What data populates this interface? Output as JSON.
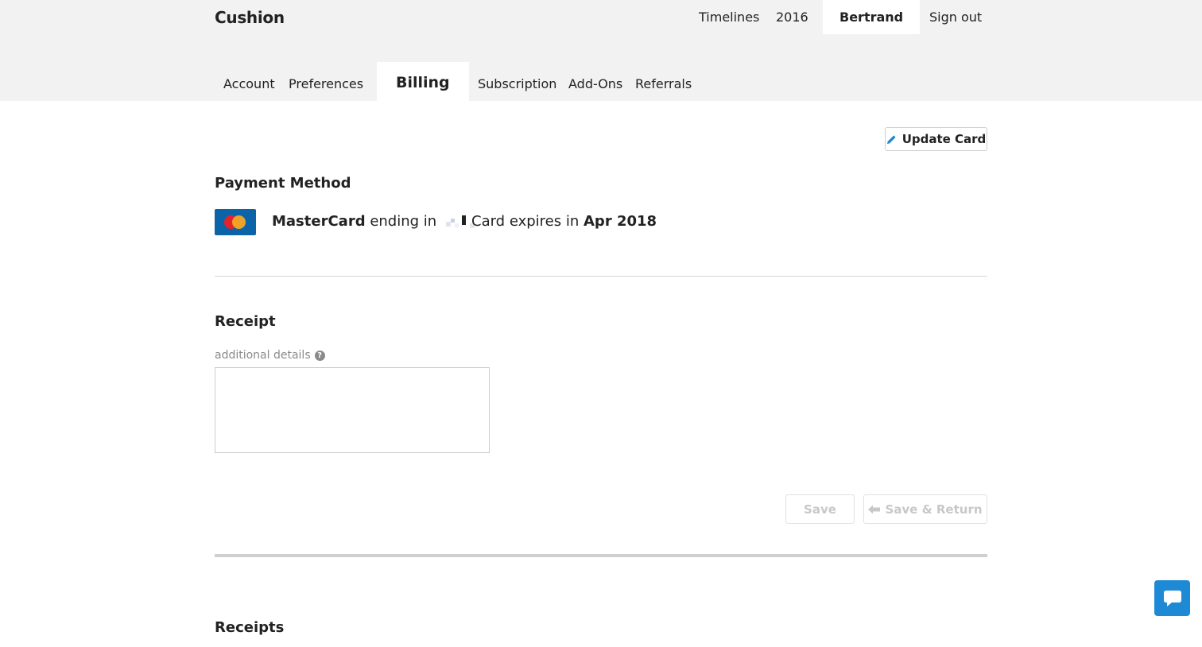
{
  "header": {
    "brand": "Cushion",
    "nav": {
      "timelines": "Timelines",
      "year": "2016",
      "user": "Bertrand",
      "signout": "Sign out"
    }
  },
  "tabs": [
    {
      "label": "Account"
    },
    {
      "label": "Preferences"
    },
    {
      "label": "Billing"
    },
    {
      "label": "Subscription"
    },
    {
      "label": "Add-Ons"
    },
    {
      "label": "Referrals"
    }
  ],
  "active_tab": "Billing",
  "payment": {
    "update_button": "Update Card",
    "title": "Payment Method",
    "card_brand": "MasterCard",
    "ending_text": "ending in",
    "expires_text": "Card expires in",
    "expiry": "Apr 2018"
  },
  "receipt": {
    "title": "Receipt",
    "field_label": "additional details",
    "field_value": "",
    "save_label": "Save",
    "save_return_label": "Save & Return"
  },
  "receipts": {
    "title": "Receipts"
  },
  "colors": {
    "topbar_bg": "#f2f2f2",
    "card_blue": "#0b63a8",
    "chat_blue": "#1e8ad6",
    "pencil_blue": "#1e8ad6"
  },
  "icons": [
    "pencil-icon",
    "mastercard-icon",
    "help-icon",
    "arrow-left-icon",
    "chat-icon"
  ]
}
